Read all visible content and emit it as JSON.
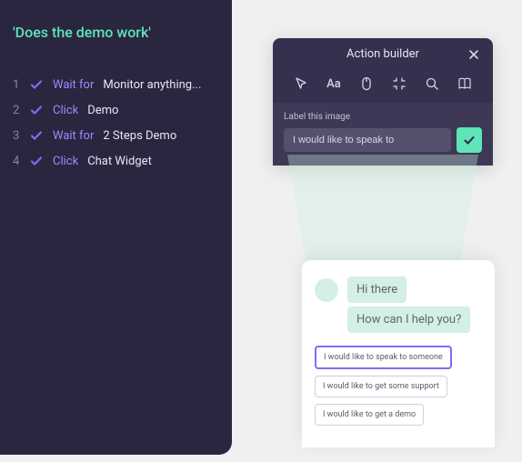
{
  "sidebar": {
    "title": "'Does the demo work'",
    "steps": [
      {
        "num": "1",
        "action": "Wait for",
        "target": "Monitor anything..."
      },
      {
        "num": "2",
        "action": "Click",
        "target": "Demo"
      },
      {
        "num": "3",
        "action": "Wait for",
        "target": "2 Steps Demo"
      },
      {
        "num": "4",
        "action": "Click",
        "target": "Chat Widget"
      }
    ]
  },
  "actionBuilder": {
    "title": "Action builder",
    "label": "Label this image",
    "inputValue": "I would like to speak to"
  },
  "chat": {
    "greeting1": "Hi there",
    "greeting2": "How can I help you?",
    "options": [
      "I would like to speak to someone",
      "I would like to get some support",
      "I would like to get a demo"
    ]
  }
}
